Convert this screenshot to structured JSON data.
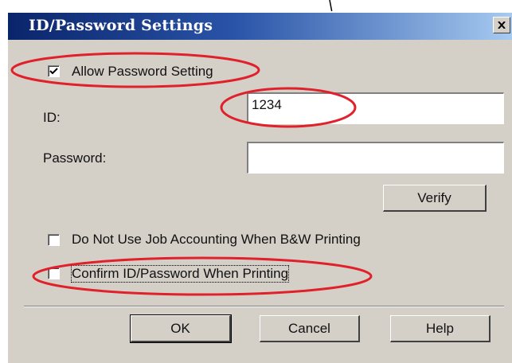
{
  "dialog": {
    "title": "ID/Password Settings",
    "close_symbol": "×",
    "allow_password": {
      "label": "Allow Password Setting",
      "checked": true
    },
    "id_label": "ID:",
    "id_value": "1234",
    "password_label": "Password:",
    "password_value": "",
    "verify_button": "Verify",
    "no_job_accounting": {
      "label": "Do Not Use Job Accounting When B&W Printing",
      "checked": false
    },
    "confirm_id_password": {
      "label": "Confirm ID/Password When Printing",
      "checked": false
    },
    "ok_button": "OK",
    "cancel_button": "Cancel",
    "help_button": "Help"
  },
  "colors": {
    "titlebar_start": "#0a246a",
    "titlebar_end": "#a6caf0",
    "dialog_face": "#d4d0c8",
    "annotation_red": "#e0202a"
  },
  "icons": [
    "close-icon",
    "checkmark-icon"
  ]
}
